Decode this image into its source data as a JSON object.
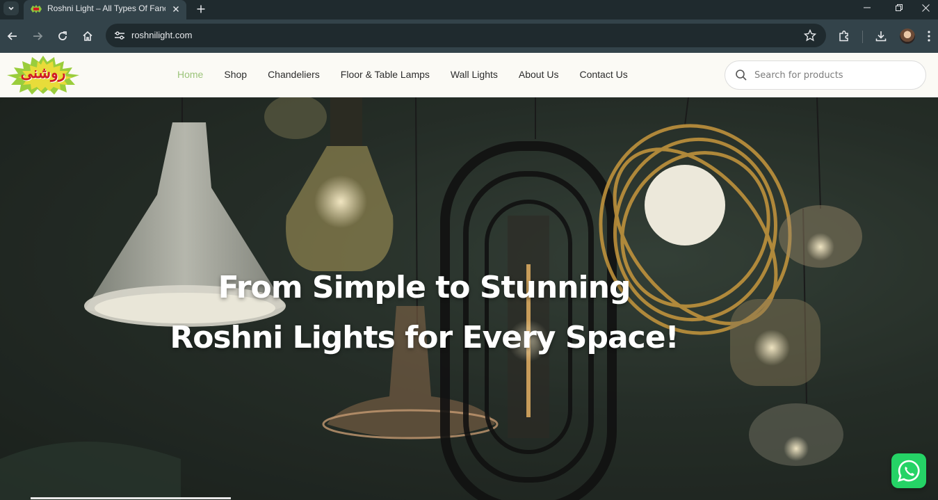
{
  "browser": {
    "tab_title": "Roshni Light – All Types Of Fanc",
    "url": "roshnilight.com"
  },
  "site": {
    "logo_text": "روشنی",
    "nav": [
      {
        "label": "Home",
        "active": true
      },
      {
        "label": "Shop"
      },
      {
        "label": "Chandeliers"
      },
      {
        "label": "Floor & Table Lamps"
      },
      {
        "label": "Wall Lights"
      },
      {
        "label": "About Us"
      },
      {
        "label": "Contact Us"
      }
    ],
    "search_placeholder": "Search for products"
  },
  "hero": {
    "line1": "From Simple to Stunning",
    "line2": "Roshni Lights for Every Space!"
  },
  "colors": {
    "nav_active": "#9cc47a",
    "whatsapp": "#25d366",
    "logo_red": "#d01c22",
    "logo_burst": "#8dc63f"
  },
  "icons": [
    "chevron-down-icon",
    "close-icon",
    "plus-icon",
    "minimize-icon",
    "restore-icon",
    "back-icon",
    "forward-icon",
    "reload-icon",
    "home-icon",
    "tune-icon",
    "star-icon",
    "extensions-icon",
    "download-icon",
    "kebab-menu-icon",
    "search-icon",
    "whatsapp-icon"
  ]
}
